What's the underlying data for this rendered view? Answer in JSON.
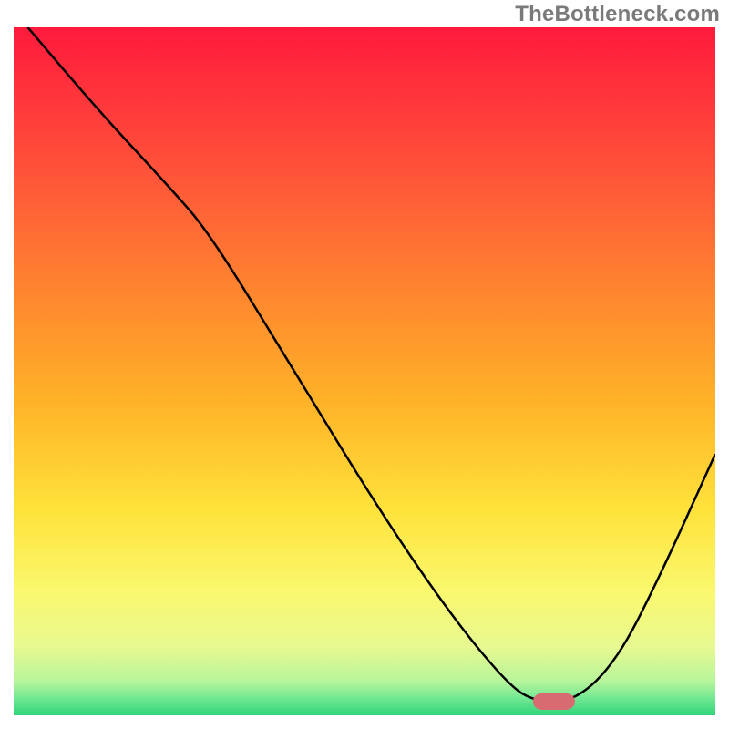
{
  "watermark": "TheBottleneck.com",
  "chart_data": {
    "type": "line",
    "title": "",
    "xlabel": "",
    "ylabel": "",
    "xlim": [
      0,
      100
    ],
    "ylim": [
      0,
      100
    ],
    "grid": false,
    "series": [
      {
        "name": "curve",
        "x": [
          2,
          12,
          22,
          28,
          40,
          52,
          62,
          70,
          74,
          80,
          86,
          92,
          100
        ],
        "y": [
          100,
          88,
          77,
          70,
          50,
          30,
          15,
          5,
          2,
          2,
          8,
          20,
          38
        ]
      }
    ],
    "marker": {
      "x_start": 74,
      "x_end": 80,
      "y": 2,
      "color": "#d86b72"
    },
    "gradient_stops": [
      {
        "offset": 0.0,
        "color": "#ff1a3c"
      },
      {
        "offset": 0.2,
        "color": "#ff503a"
      },
      {
        "offset": 0.4,
        "color": "#ff8a2e"
      },
      {
        "offset": 0.55,
        "color": "#ffb428"
      },
      {
        "offset": 0.7,
        "color": "#ffe23a"
      },
      {
        "offset": 0.82,
        "color": "#faf86e"
      },
      {
        "offset": 0.9,
        "color": "#e8f990"
      },
      {
        "offset": 0.95,
        "color": "#b8f59a"
      },
      {
        "offset": 0.975,
        "color": "#72e893"
      },
      {
        "offset": 1.0,
        "color": "#2fd47a"
      }
    ],
    "curve_stroke": "#000000",
    "curve_width": 2.5
  }
}
